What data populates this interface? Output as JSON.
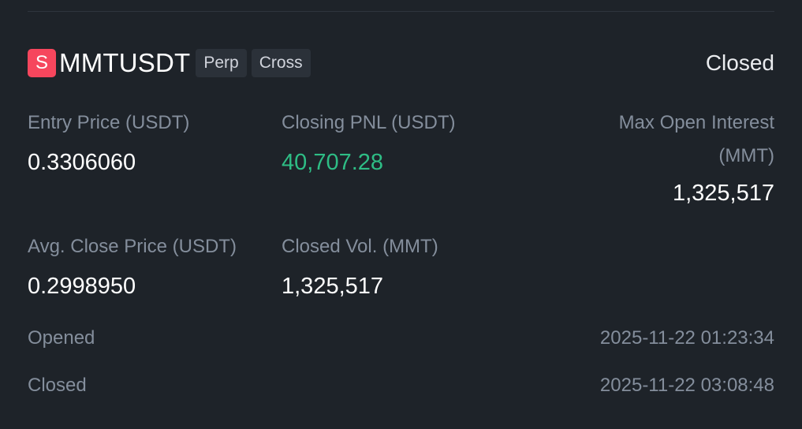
{
  "position": {
    "side_letter": "S",
    "symbol": "MMTUSDT",
    "tags": [
      "Perp",
      "Cross"
    ],
    "status": "Closed",
    "side_color": "#f6465d",
    "pnl_color": "#2ebd85"
  },
  "metrics": {
    "entry_price": {
      "label": "Entry Price (USDT)",
      "value": "0.3306060"
    },
    "closing_pnl": {
      "label": "Closing PNL (USDT)",
      "value": "40,707.28"
    },
    "max_open_interest": {
      "label_line1": "Max Open Interest",
      "label_line2": "(MMT)",
      "value": "1,325,517"
    },
    "avg_close_price": {
      "label": "Avg. Close Price (USDT)",
      "value": "0.2998950"
    },
    "closed_vol": {
      "label": "Closed Vol. (MMT)",
      "value": "1,325,517"
    }
  },
  "times": {
    "opened": {
      "label": "Opened",
      "value": "2025-11-22 01:23:34"
    },
    "closed": {
      "label": "Closed",
      "value": "2025-11-22 03:08:48"
    }
  }
}
